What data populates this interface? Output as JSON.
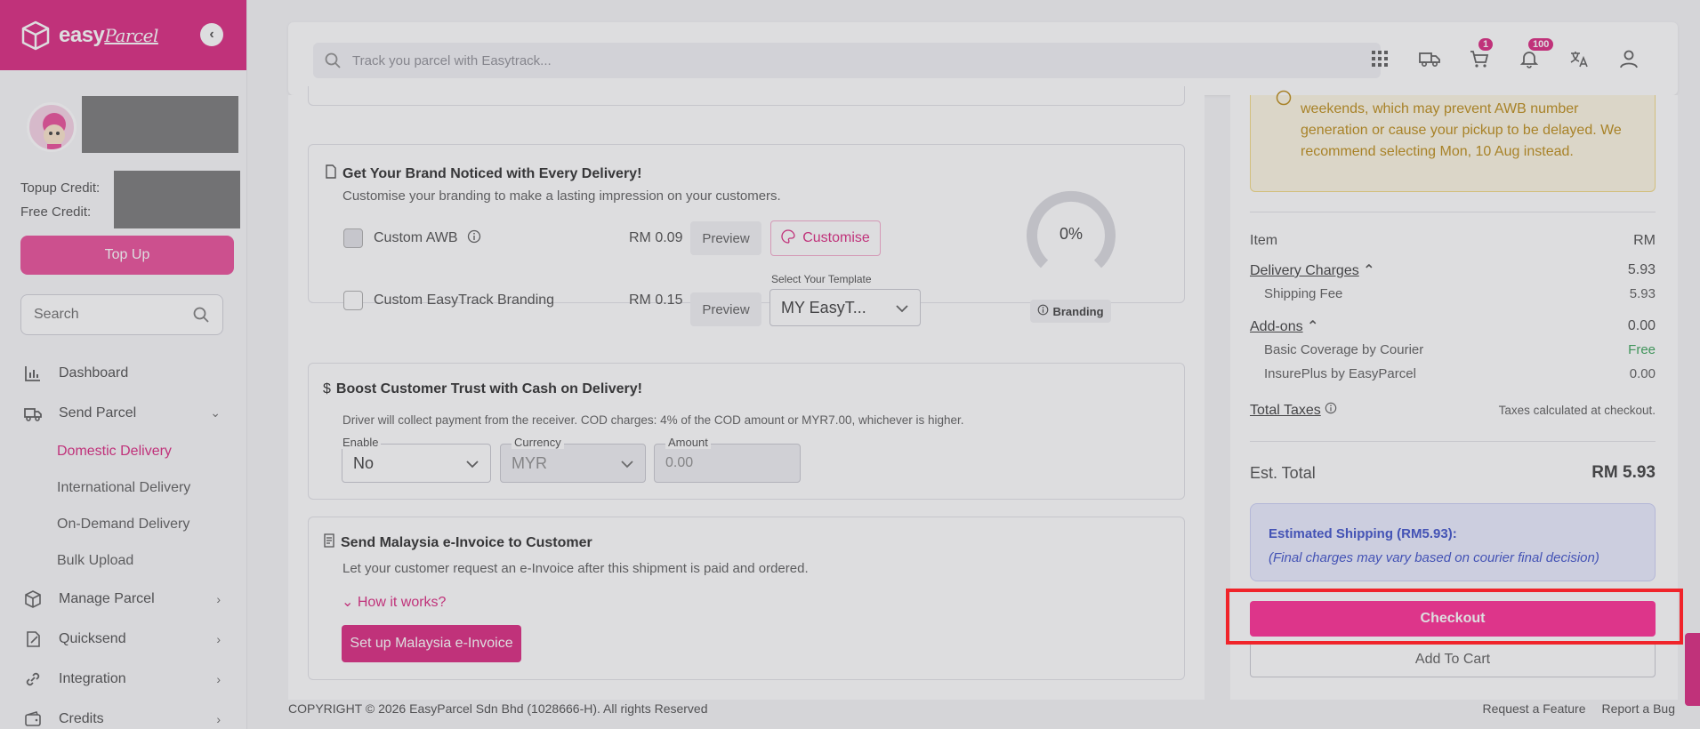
{
  "brand": {
    "name": "easy",
    "name_script": "Parcel"
  },
  "sidebar": {
    "topup_credit_label": "Topup Credit:",
    "free_credit_label": "Free Credit:",
    "topup_button": "Top Up",
    "search_placeholder": "Search",
    "items": [
      {
        "label": "Dashboard",
        "icon": "chart-icon"
      },
      {
        "label": "Send Parcel",
        "icon": "truck-icon",
        "expanded": true
      },
      {
        "label": "Domestic Delivery",
        "sub": true,
        "active": true
      },
      {
        "label": "International Delivery",
        "sub": true
      },
      {
        "label": "On-Demand Delivery",
        "sub": true
      },
      {
        "label": "Bulk Upload",
        "sub": true
      },
      {
        "label": "Manage Parcel",
        "icon": "box-icon"
      },
      {
        "label": "Quicksend",
        "icon": "quicksend-icon"
      },
      {
        "label": "Integration",
        "icon": "link-icon"
      },
      {
        "label": "Credits",
        "icon": "wallet-icon"
      }
    ]
  },
  "header": {
    "search_placeholder": "Track you parcel with Easytrack...",
    "cart_badge": "1",
    "notif_badge": "100"
  },
  "branding_card": {
    "title": "Get Your Brand Noticed with Every Delivery!",
    "subtitle": "Customise your branding to make a lasting impression on your customers.",
    "custom_awb": {
      "label": "Custom AWB",
      "price": "RM 0.09",
      "preview": "Preview",
      "customise": "Customise"
    },
    "custom_easytrack": {
      "label": "Custom EasyTrack Branding",
      "price": "RM 0.15",
      "preview": "Preview"
    },
    "template_label": "Select Your Template",
    "template_value": "MY EasyT...",
    "progress_text": "0%",
    "progress_value": 0,
    "branding_pill": "Branding"
  },
  "cod_card": {
    "title": "Boost Customer Trust with Cash on Delivery!",
    "subtitle": "Driver will collect payment from the receiver. COD charges: 4% of the COD amount or MYR7.00, whichever is higher.",
    "enable_label": "Enable",
    "enable_value": "No",
    "currency_label": "Currency",
    "currency_value": "MYR",
    "amount_label": "Amount",
    "amount_value": "0.00"
  },
  "einvoice_card": {
    "title": "Send Malaysia e-Invoice to Customer",
    "subtitle": "Let your customer request an e-Invoice after this shipment is paid and ordered.",
    "how_link": "How it works?",
    "setup_button": "Set up Malaysia e-Invoice"
  },
  "summary": {
    "warning_text": "weekends, which may prevent AWB number generation or cause your pickup to be delayed. We recommend selecting Mon, 10 Aug instead.",
    "item_label": "Item",
    "currency_header": "RM",
    "delivery_charges_label": "Delivery Charges",
    "delivery_charges_value": "5.93",
    "shipping_fee_label": "Shipping Fee",
    "shipping_fee_value": "5.93",
    "addons_label": "Add-ons",
    "addons_value": "0.00",
    "basic_coverage_label": "Basic Coverage by Courier",
    "basic_coverage_value": "Free",
    "insureplus_label": "InsurePlus by EasyParcel",
    "insureplus_value": "0.00",
    "total_taxes_label": "Total Taxes",
    "total_taxes_note": "Taxes calculated at checkout.",
    "est_total_label": "Est. Total",
    "est_total_value": "RM 5.93",
    "est_shipping_title": "Estimated Shipping (RM5.93):",
    "est_shipping_note": "(Final charges may vary based on courier final decision)",
    "checkout_button": "Checkout",
    "add_to_cart_button": "Add To Cart"
  },
  "footer": {
    "copyright": "COPYRIGHT © 2026 EasyParcel Sdn Bhd (1028666-H). All rights Reserved",
    "request_feature": "Request a Feature",
    "report_bug": "Report a Bug"
  },
  "colors": {
    "brand": "#d81b78",
    "checkout": "#ff1f8e",
    "highlight": "#f0242a"
  }
}
